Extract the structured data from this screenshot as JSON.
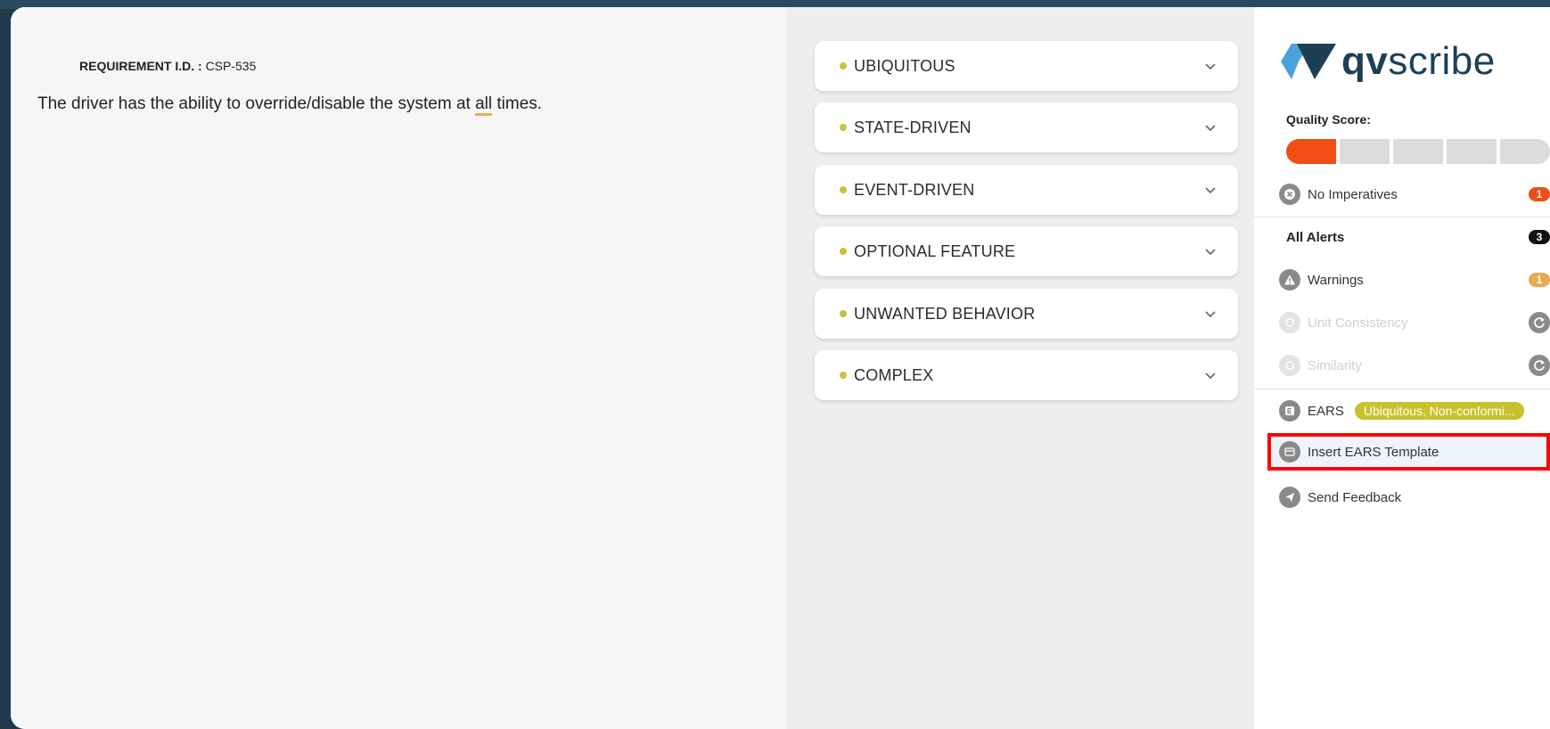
{
  "editor": {
    "requirement_id_label": "REQUIREMENT I.D. :",
    "requirement_id_value": "CSP-535",
    "text_before": "The driver has the ability to override/disable the system at ",
    "text_highlight": "all",
    "text_after": " times."
  },
  "templates": {
    "items": [
      {
        "label": "UBIQUITOUS"
      },
      {
        "label": "STATE-DRIVEN"
      },
      {
        "label": "EVENT-DRIVEN"
      },
      {
        "label": "OPTIONAL FEATURE"
      },
      {
        "label": "UNWANTED BEHAVIOR"
      },
      {
        "label": "COMPLEX"
      }
    ]
  },
  "panel": {
    "logo_bold": "qv",
    "logo_light": "scribe",
    "quality_score_label": "Quality Score:",
    "quality_score_level": 1,
    "quality_score_segments": 5,
    "no_imperatives": {
      "label": "No Imperatives",
      "count": "1"
    },
    "all_alerts": {
      "label": "All Alerts",
      "count": "3"
    },
    "warnings": {
      "label": "Warnings",
      "count": "1"
    },
    "unit_consistency": {
      "label": "Unit Consistency"
    },
    "similarity": {
      "label": "Similarity"
    },
    "ears": {
      "label": "EARS",
      "value": "Ubiquitous, Non-conformi..."
    },
    "insert_ears_template": {
      "label": "Insert EARS Template"
    },
    "send_feedback": {
      "label": "Send Feedback"
    }
  },
  "colors": {
    "accent_orange": "#f04e14",
    "template_dot": "#c5c243",
    "ears_pill": "#c9c22e",
    "warning_amber": "#e8aa52",
    "brand_navy": "#1d3f56",
    "brand_blue": "#4aa3d8"
  }
}
